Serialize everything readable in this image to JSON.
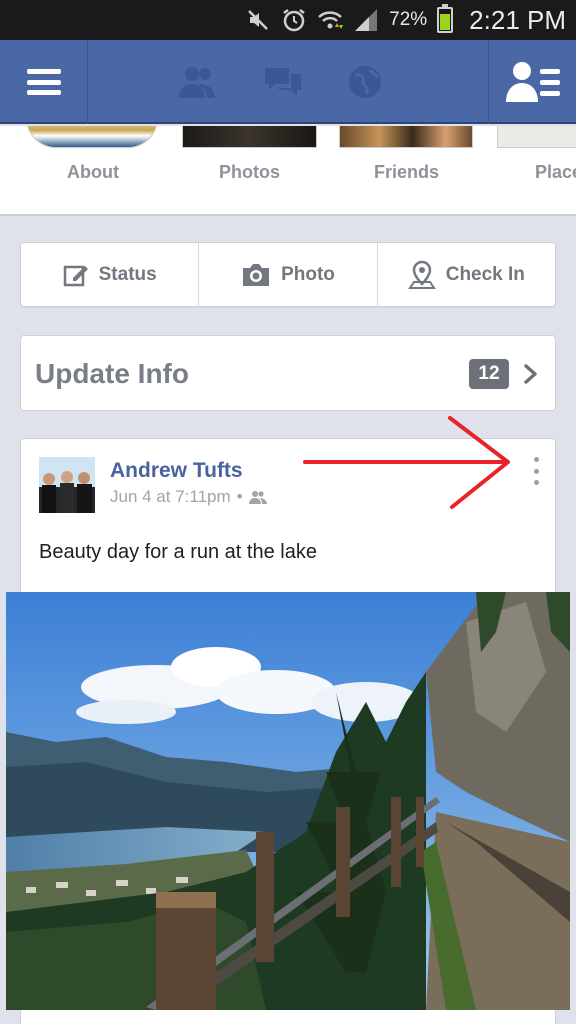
{
  "status_bar": {
    "battery_text": "72%",
    "battery_level": 0.72,
    "time": "2:21 PM",
    "icons": [
      "mute-icon",
      "alarm-icon",
      "wifi-icon",
      "signal-icon",
      "battery-icon"
    ]
  },
  "navbar": {
    "left_icon": "menu-icon",
    "center_icons": [
      "friend-requests-icon",
      "messages-icon",
      "notifications-globe-icon"
    ],
    "right_icon": "friends-list-icon",
    "color": "#4a67a6"
  },
  "profile_tabs": [
    {
      "label": "About"
    },
    {
      "label": "Photos"
    },
    {
      "label": "Friends"
    },
    {
      "label": "Place"
    }
  ],
  "composer": {
    "status_label": "Status",
    "photo_label": "Photo",
    "checkin_label": "Check In"
  },
  "update_info": {
    "title": "Update Info",
    "count": "12"
  },
  "post": {
    "author": "Andrew Tufts",
    "timestamp": "Jun 4 at 7:11pm",
    "separator": "•",
    "audience_icon": "friends-audience-icon",
    "text": "Beauty day for a run at the lake",
    "more_icon": "more-options-icon"
  },
  "colors": {
    "accent": "#4a67a6",
    "link": "#4b62a0",
    "annotation": "#e8232a"
  }
}
